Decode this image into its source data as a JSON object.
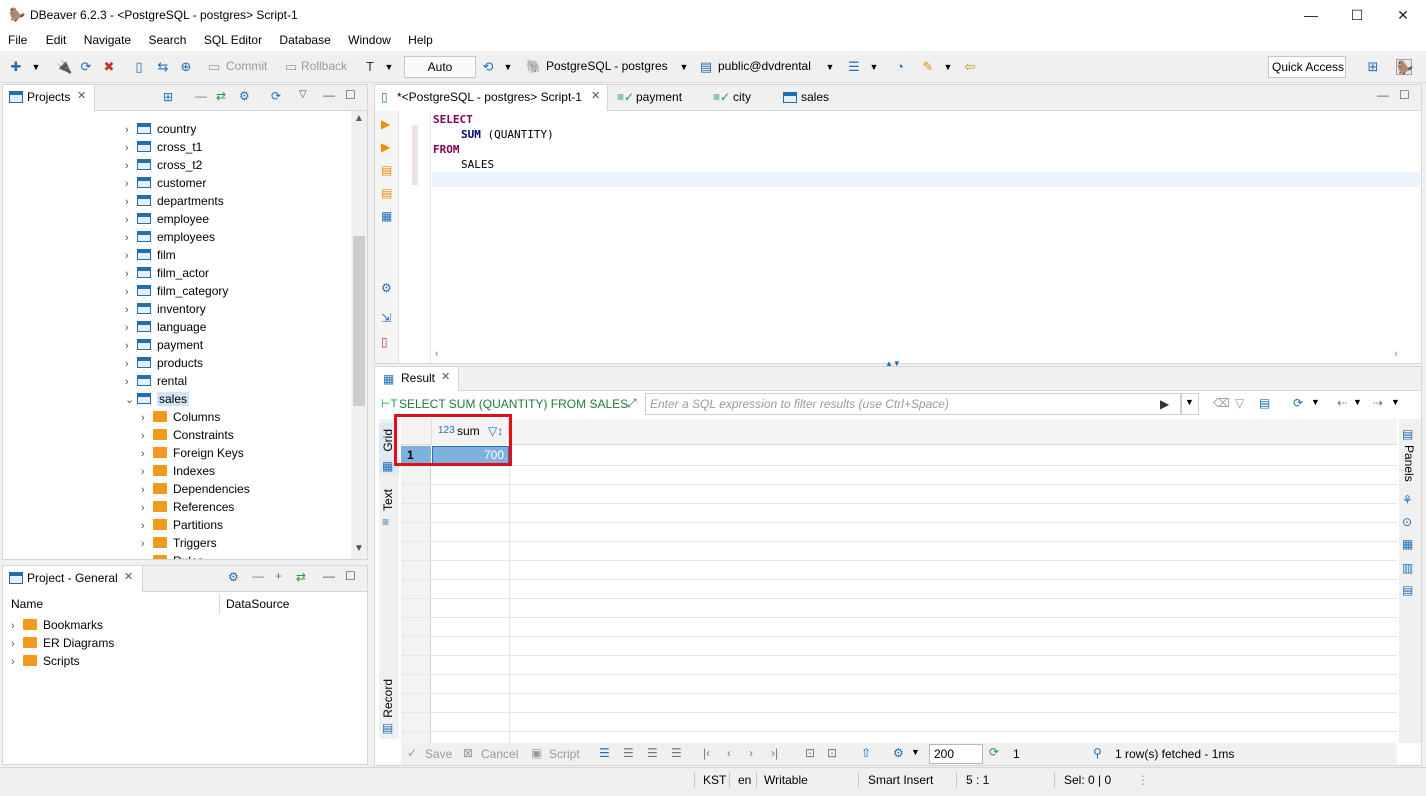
{
  "window": {
    "title": "DBeaver 6.2.3 - <PostgreSQL - postgres> Script-1",
    "minimize": "—",
    "maximize": "☐",
    "close": "✕"
  },
  "menu": [
    "File",
    "Edit",
    "Navigate",
    "Search",
    "SQL Editor",
    "Database",
    "Window",
    "Help"
  ],
  "toolbar": {
    "commit": "Commit",
    "rollback": "Rollback",
    "transaction_mode": "Auto",
    "connection": "PostgreSQL - postgres",
    "schema": "public@dvdrental",
    "quick_access": "Quick Access"
  },
  "projects_panel": {
    "tab_label": "Projects",
    "tree": [
      {
        "label": "country",
        "type": "table"
      },
      {
        "label": "cross_t1",
        "type": "table"
      },
      {
        "label": "cross_t2",
        "type": "table"
      },
      {
        "label": "customer",
        "type": "table"
      },
      {
        "label": "departments",
        "type": "table"
      },
      {
        "label": "employee",
        "type": "table"
      },
      {
        "label": "employees",
        "type": "table"
      },
      {
        "label": "film",
        "type": "table"
      },
      {
        "label": "film_actor",
        "type": "table"
      },
      {
        "label": "film_category",
        "type": "table"
      },
      {
        "label": "inventory",
        "type": "table"
      },
      {
        "label": "language",
        "type": "table"
      },
      {
        "label": "payment",
        "type": "table"
      },
      {
        "label": "products",
        "type": "table"
      },
      {
        "label": "rental",
        "type": "table"
      },
      {
        "label": "sales",
        "type": "table-open"
      },
      {
        "label": "Columns",
        "type": "folder"
      },
      {
        "label": "Constraints",
        "type": "folder"
      },
      {
        "label": "Foreign Keys",
        "type": "folder"
      },
      {
        "label": "Indexes",
        "type": "folder"
      },
      {
        "label": "Dependencies",
        "type": "folder"
      },
      {
        "label": "References",
        "type": "folder"
      },
      {
        "label": "Partitions",
        "type": "folder"
      },
      {
        "label": "Triggers",
        "type": "folder"
      },
      {
        "label": "Rules",
        "type": "folder"
      }
    ]
  },
  "general_panel": {
    "tab_label": "Project - General",
    "col_name": "Name",
    "col_datasource": "DataSource",
    "items": [
      "Bookmarks",
      "ER Diagrams",
      "Scripts"
    ]
  },
  "editor": {
    "tabs": [
      "*<PostgreSQL - postgres> Script-1",
      "payment",
      "city",
      "sales"
    ],
    "code_lines": [
      {
        "kw": "SELECT",
        "rest": ""
      },
      {
        "kw": "",
        "fn": "SUM",
        "rest": " (QUANTITY)"
      },
      {
        "kw": "FROM",
        "rest": ""
      },
      {
        "kw": "",
        "rest": "SALES"
      }
    ]
  },
  "result": {
    "tab_label": "Result",
    "query_label": "SELECT SUM (QUANTITY) FROM SALES",
    "filter_placeholder": "Enter a SQL expression to filter results (use Ctrl+Space)",
    "column_type": "123",
    "column_name": "sum",
    "row_number": "1",
    "row_value": "700",
    "side_tabs": {
      "grid": "Grid",
      "text": "Text",
      "record": "Record",
      "panels": "Panels"
    },
    "bottom": {
      "save": "Save",
      "cancel": "Cancel",
      "script": "Script",
      "fetch_size": "200",
      "fetched_count": "1",
      "fetched_msg": "1 row(s) fetched - 1ms"
    }
  },
  "statusbar": {
    "tz": "KST",
    "lang": "en",
    "mode": "Writable",
    "insert": "Smart Insert",
    "pos": "5 : 1",
    "sel": "Sel: 0 | 0"
  },
  "colors": {
    "selection_highlight": "#cfe4f8",
    "highlight_box": "#e0101a",
    "keyword": "#7f0055"
  }
}
